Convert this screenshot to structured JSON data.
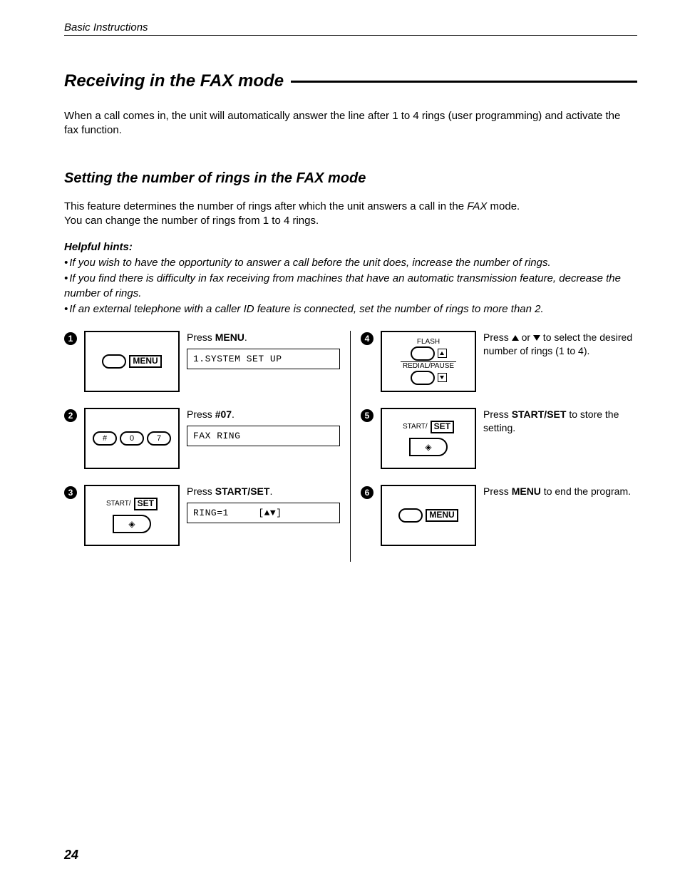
{
  "header": "Basic Instructions",
  "title": "Receiving in the FAX mode",
  "intro": "When a call comes in, the unit will automatically answer the line after 1 to 4 rings (user programming) and activate the fax function.",
  "subtitle": "Setting the number of rings in the FAX mode",
  "desc1": "This feature determines the number of rings after which the unit answers a call in the ",
  "desc1_em": "FAX",
  "desc1_tail": " mode.",
  "desc2": "You can change the number of rings from 1 to 4 rings.",
  "hints_title": "Helpful hints:",
  "hints": [
    "If you wish to have the opportunity to answer a call before the unit does, increase the number of rings.",
    "If you find there is difficulty in fax receiving from machines that have an automatic transmission feature, decrease the number of rings.",
    "If an external telephone with a caller ID feature is connected, set the number of rings to more than 2."
  ],
  "steps": {
    "s1": {
      "num": "1",
      "instr_pre": "Press ",
      "instr_b": "MENU",
      "instr_post": ".",
      "lcd": "1.SYSTEM SET UP",
      "panel_label": "MENU"
    },
    "s2": {
      "num": "2",
      "instr_pre": "Press ",
      "instr_b": "#07",
      "instr_post": ".",
      "lcd": "FAX RING",
      "keys": [
        "#",
        "0",
        "7"
      ]
    },
    "s3": {
      "num": "3",
      "instr_pre": "Press ",
      "instr_b": "START/SET",
      "instr_post": ".",
      "lcd": "RING=1     [▲▼]",
      "panel_top": "START/",
      "panel_box": "SET"
    },
    "s4": {
      "num": "4",
      "instr": "Press ▲ or ▼ to select the desired number of rings (1 to 4).",
      "panel_flash": "FLASH",
      "panel_redial": "REDIAL/PAUSE"
    },
    "s5": {
      "num": "5",
      "instr_pre": "Press ",
      "instr_b": "START/SET",
      "instr_post": " to store the setting.",
      "panel_top": "START/",
      "panel_box": "SET"
    },
    "s6": {
      "num": "6",
      "instr_pre": "Press ",
      "instr_b": "MENU",
      "instr_post": " to end the program.",
      "panel_label": "MENU"
    }
  },
  "page_number": "24",
  "icons": {
    "diamond": "◈",
    "up_small": "▲",
    "down_small": "▼"
  }
}
